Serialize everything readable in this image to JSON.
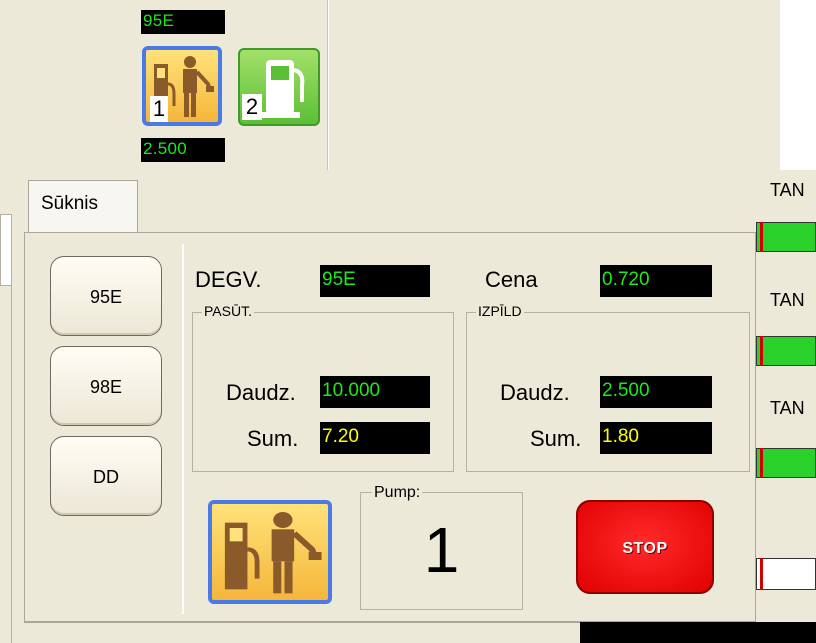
{
  "top": {
    "pump1": {
      "number": "1",
      "fuel": "95E",
      "amount": "2.500"
    },
    "pump2": {
      "number": "2"
    }
  },
  "tab": {
    "label": "Sūknis"
  },
  "fuels": [
    "95E",
    "98E",
    "DD"
  ],
  "info": {
    "degv_label": "DEGV.",
    "degv_value": "95E",
    "cena_label": "Cena",
    "cena_value": "0.720"
  },
  "ordered": {
    "title": "PASŪT.",
    "qty_label": "Daudz.",
    "qty_value": "10.000",
    "sum_label": "Sum.",
    "sum_value": "7.20"
  },
  "done": {
    "title": "IZPĪLD",
    "qty_label": "Daudz.",
    "qty_value": "2.500",
    "sum_label": "Sum.",
    "sum_value": "1.80"
  },
  "pump": {
    "title": "Pump:",
    "value": "1"
  },
  "stop_label": "STOP",
  "tanks": [
    {
      "label": "TAN"
    },
    {
      "label": "TAN"
    },
    {
      "label": "TAN"
    }
  ],
  "colors": {
    "lcd_green": "#1ee81e",
    "lcd_yellow": "#ffff00",
    "stop_red": "#ff0000",
    "tank_green": "#2bd12b"
  }
}
